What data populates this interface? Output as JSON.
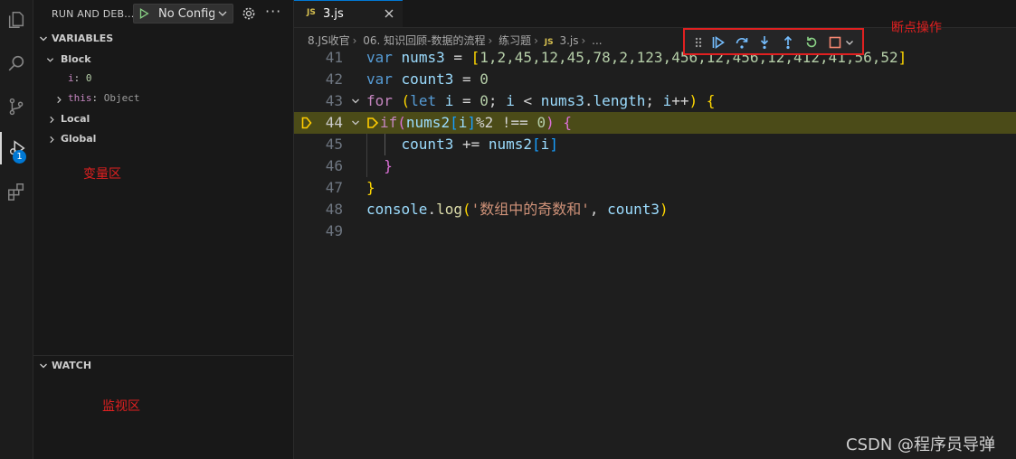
{
  "activity_bar": {
    "items": [
      {
        "icon": "explorer-icon"
      },
      {
        "icon": "search-icon"
      },
      {
        "icon": "source-control-icon"
      },
      {
        "icon": "run-debug-icon",
        "badge": "1",
        "active": true
      },
      {
        "icon": "extensions-icon"
      }
    ]
  },
  "sidebar": {
    "title": "RUN AND DEB...",
    "config_label": "No Configu",
    "sections": {
      "variables": "VARIABLES",
      "watch": "WATCH"
    },
    "variables": {
      "block": "Block",
      "block_vars": [
        {
          "name": "i",
          "sep": ": ",
          "value": "0"
        },
        {
          "name": "this",
          "sep": ": ",
          "value": "Object"
        }
      ],
      "local": "Local",
      "global": "Global"
    },
    "annotations": {
      "variables_area": "变量区",
      "watch_area": "监视区"
    }
  },
  "editor": {
    "tab": {
      "icon_text": "JS",
      "name": "3.js"
    },
    "breadcrumb": [
      "8.JS收官",
      "06. 知识回顾-数据的流程",
      "练习题",
      "3.js",
      "..."
    ],
    "breadcrumb_js": "JS",
    "current_line": 44,
    "lines": [
      {
        "num": "41"
      },
      {
        "num": "42"
      },
      {
        "num": "43"
      },
      {
        "num": "44"
      },
      {
        "num": "45"
      },
      {
        "num": "46"
      },
      {
        "num": "47"
      },
      {
        "num": "48"
      },
      {
        "num": "49"
      }
    ],
    "code": {
      "l41": {
        "kw": "var",
        "name": "nums3",
        "eq": " = ",
        "open": "[",
        "nums": "1,2,45,12,45,78,2,123,456,12,456,12,412,41,56,52",
        "close": "]"
      },
      "l42": {
        "kw": "var",
        "name": "count3",
        "rest": " = ",
        "num": "0"
      },
      "l43": {
        "kw": "for",
        "open": "(",
        "let": "let",
        "i1": "i",
        "eq": " = ",
        "zero": "0",
        "semi1": "; ",
        "i2": "i",
        "lt": " < ",
        "arr": "nums3",
        "dot": ".",
        "len": "length",
        "semi2": "; ",
        "i3": "i",
        "inc": "++",
        "close": ")",
        "brace": "{"
      },
      "l44": {
        "kw": "if",
        "open": "(",
        "arr": "nums2",
        "bo": "[",
        "i": "i",
        "bc": "]",
        "op": "%2 !== ",
        "zero": "0",
        "close": ")",
        "brace": "{"
      },
      "l45": {
        "name": "count3",
        "op": " += ",
        "arr": "nums2",
        "bo": "[",
        "i": "i",
        "bc": "]"
      },
      "l46": {
        "brace": "}"
      },
      "l47": {
        "brace": "}"
      },
      "l48": {
        "obj": "console",
        "dot": ".",
        "fn": "log",
        "open": "(",
        "str": "'数组中的奇数和'",
        "comma": ", ",
        "name": "count3",
        "close": ")"
      }
    }
  },
  "debug_toolbar": {
    "buttons": [
      "continue",
      "step-over",
      "step-into",
      "step-out",
      "restart",
      "stop"
    ],
    "annotation": "断点操作"
  },
  "watermark": "CSDN @程序员导弹",
  "colors": {
    "accent_blue": "#0078d4",
    "debug_green": "#89d185",
    "debug_blue": "#75beff",
    "current_line_highlight": "#4b4b18",
    "breakpoint_arrow": "#ffcc00",
    "annotation_red": "#e02020"
  }
}
